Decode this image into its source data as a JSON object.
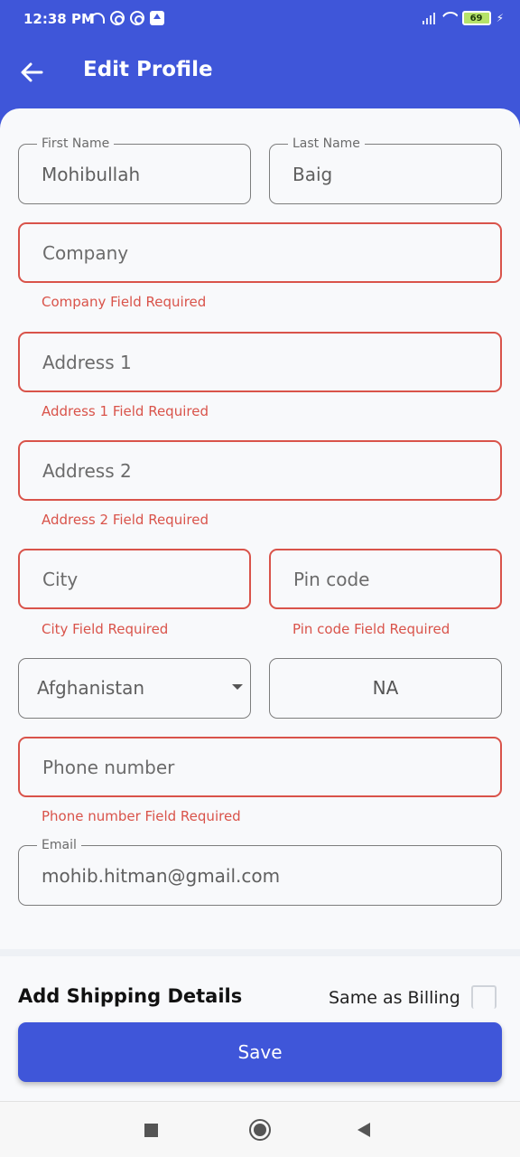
{
  "status_bar": {
    "time": "12:38 PM",
    "battery": "69",
    "left_icons": [
      "headset-icon",
      "vpn-icon",
      "vpn-icon",
      "upload-icon"
    ],
    "right_icons": [
      "signal-icon",
      "wifi-icon",
      "battery-icon",
      "charging-icon"
    ]
  },
  "app_bar": {
    "title": "Edit Profile",
    "back_icon": "arrow-left-icon"
  },
  "form": {
    "first_name": {
      "label": "First Name",
      "value": "Mohibullah"
    },
    "last_name": {
      "label": "Last Name",
      "value": "Baig"
    },
    "company": {
      "placeholder": "Company",
      "error": "Company Field Required"
    },
    "address1": {
      "placeholder": "Address 1",
      "error": "Address 1 Field Required"
    },
    "address2": {
      "placeholder": "Address 2",
      "error": "Address 2 Field Required"
    },
    "city": {
      "placeholder": "City",
      "error": "City Field Required"
    },
    "pincode": {
      "placeholder": "Pin code",
      "error": "Pin code Field Required"
    },
    "country": {
      "value": "Afghanistan"
    },
    "state": {
      "value": "NA"
    },
    "phone": {
      "placeholder": "Phone number",
      "error": "Phone number Field Required"
    },
    "email": {
      "label": "Email",
      "value": "mohib.hitman@gmail.com"
    }
  },
  "shipping": {
    "title": "Add Shipping Details",
    "same_as_billing": "Same as Billing"
  },
  "actions": {
    "save_label": "Save"
  },
  "colors": {
    "primary": "#3f56d9",
    "error": "#d9534a",
    "background": "#f8f9fb"
  }
}
